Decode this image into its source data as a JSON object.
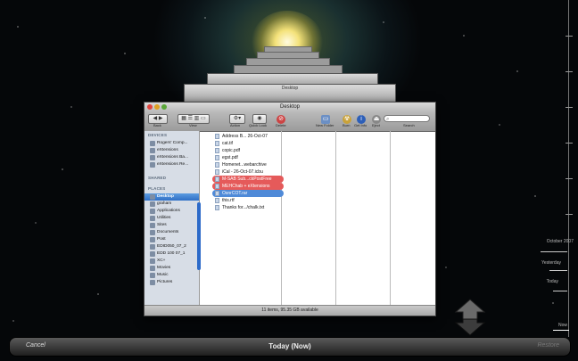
{
  "finder": {
    "window_title": "Desktop",
    "toolbar": {
      "back_label": "Back",
      "view_label": "View",
      "action_label": "Action",
      "quicklook_label": "Quick Look",
      "delete_label": "Delete",
      "newfolder_label": "New Folder",
      "burn_label": "Burn",
      "getinfo_label": "Get Info",
      "eject_label": "Eject",
      "search_label": "Search"
    },
    "sidebar": {
      "devices_header": "DEVICES",
      "devices": [
        "Rogers' Comp...",
        "eXtensions",
        "eXtensions Ba...",
        "eXtensions Re..."
      ],
      "shared_header": "SHARED",
      "places_header": "PLACES",
      "places": [
        "Desktop",
        "graham",
        "Applications",
        "Utilities",
        "Sites",
        "Documents",
        "Post",
        "EDID050_07_2",
        "EDD 100 07_1",
        "XC+",
        "Movies",
        "Music",
        "Pictures"
      ]
    },
    "files": [
      {
        "name": "Address B... 26-Oct-07",
        "highlight": "none"
      },
      {
        "name": "cat.tif",
        "highlight": "none"
      },
      {
        "name": "copic.pdf",
        "highlight": "none"
      },
      {
        "name": "egst.pdf",
        "highlight": "none"
      },
      {
        "name": "Homenet...webarchive",
        "highlight": "none"
      },
      {
        "name": "iCal - 26-Oct-07.icbu",
        "highlight": "none"
      },
      {
        "name": "M-SAB Sub...ckPostFree",
        "highlight": "red"
      },
      {
        "name": "MEHChab + eXtensions",
        "highlight": "red"
      },
      {
        "name": "OsnrCOT.rar",
        "highlight": "blue"
      },
      {
        "name": "this.rtf",
        "highlight": "none"
      },
      {
        "name": "Thanks for.../chalk.txt",
        "highlight": "none"
      }
    ],
    "status": "11 items, 95.35 GB available"
  },
  "timeline": {
    "labels": [
      "October 2007",
      "Yesterday",
      "Today",
      "Now"
    ]
  },
  "bottom_bar": {
    "cancel_label": "Cancel",
    "title": "Today (Now)",
    "restore_label": "Restore"
  }
}
